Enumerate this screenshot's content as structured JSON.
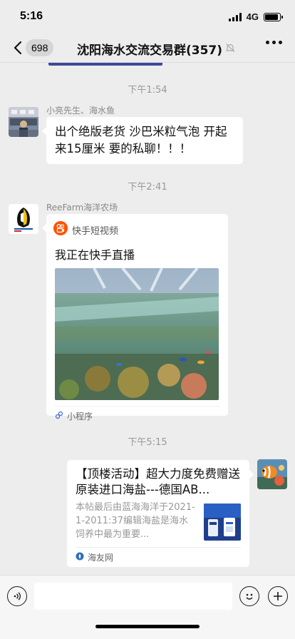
{
  "status_bar": {
    "time": "5:16",
    "network": "4G",
    "battery_level": 0.9
  },
  "nav": {
    "unread_count": "698",
    "title": "沈阳海水交流交易群(357)",
    "muted_icon": "bell-off-icon",
    "more_icon": "more-dots-icon"
  },
  "messages": [
    {
      "time": "下午1:54",
      "sender": "小亮先生、海水鱼",
      "text": "出个绝版老货 沙巴米粒气泡 开起来15厘米 要的私聊！！！"
    },
    {
      "time": "下午2:41",
      "sender": "ReeFarm海洋农场",
      "mini_program": {
        "app_name": "快手短视频",
        "title": "我正在快手直播",
        "footer": "小程序"
      }
    },
    {
      "time": "下午5:15",
      "link_card": {
        "title": "【顶楼活动】超大力度免费赠送原装进口海盐---德国AB...",
        "description": "本帖最后由蓝海海洋于2021-1-2011:37编辑海盐是海水饲养中最为重要...",
        "source": "海友网"
      }
    }
  ],
  "input": {
    "voice_icon": "voice-icon",
    "emoji_icon": "emoji-icon",
    "plus_icon": "plus-icon",
    "placeholder": ""
  },
  "colors": {
    "background": "#ededed",
    "bubble": "#ffffff",
    "kuaishou": "#ff5000"
  }
}
